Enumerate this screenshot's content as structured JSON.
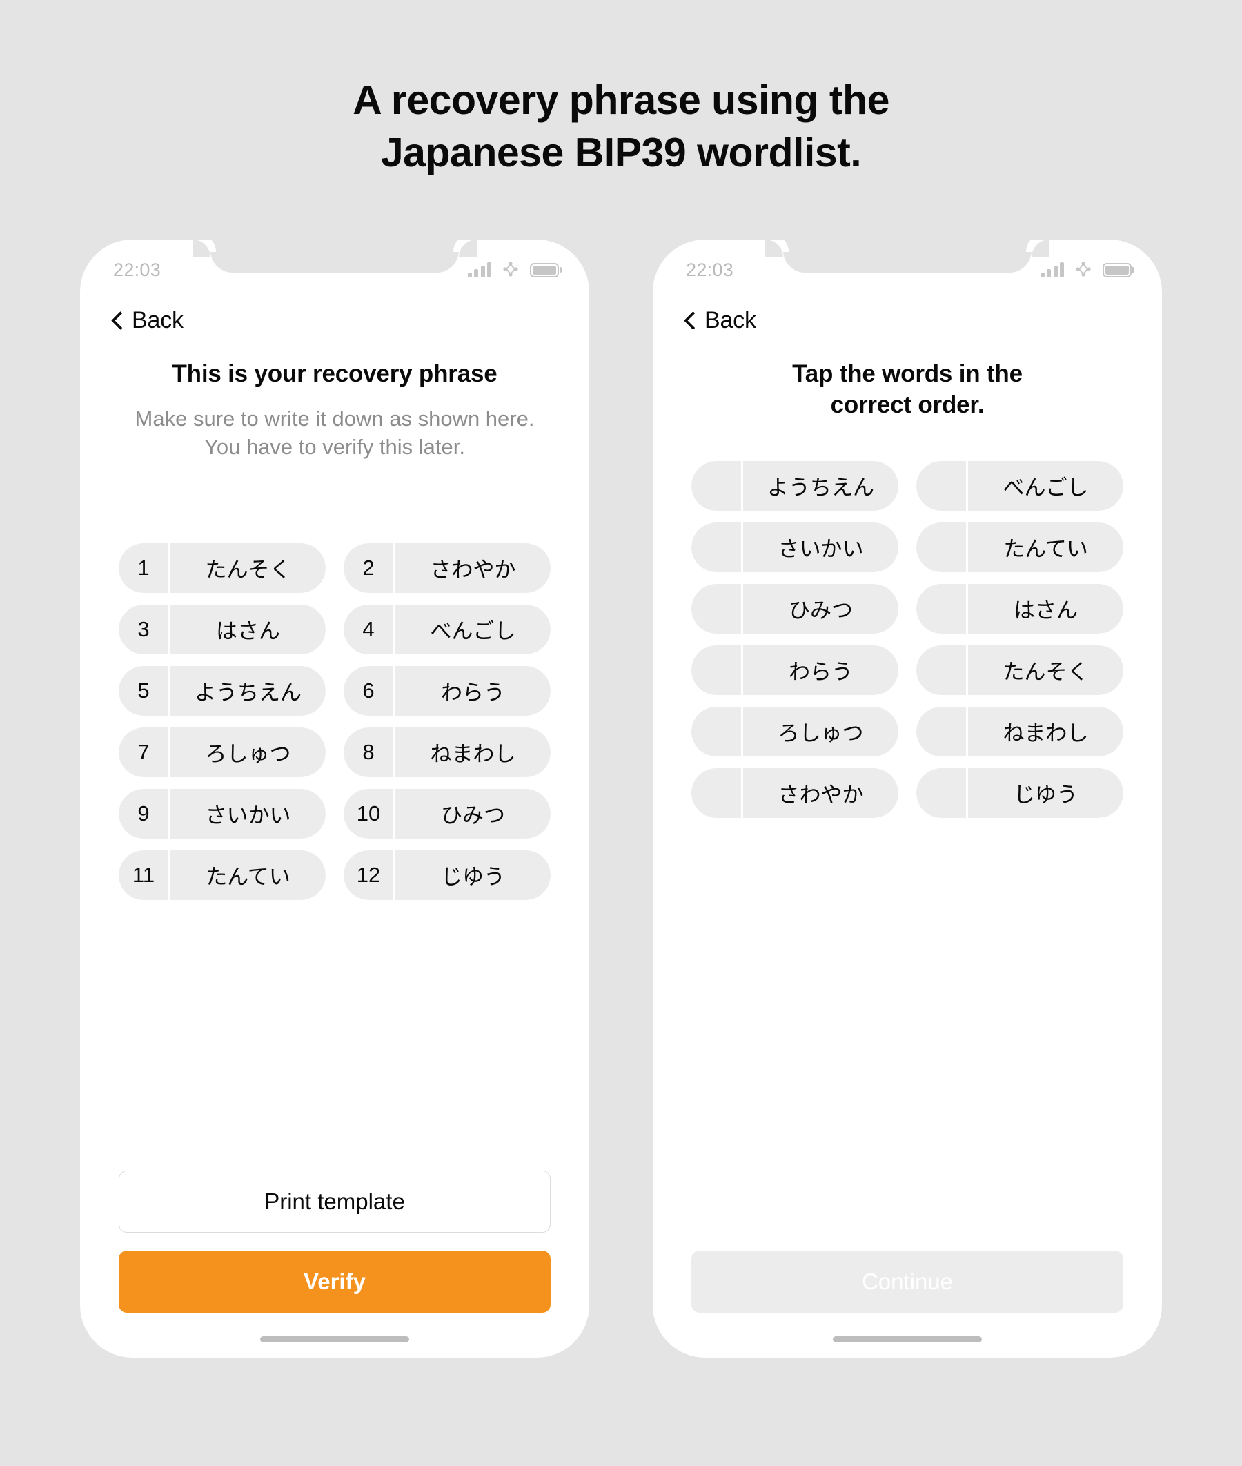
{
  "page": {
    "title_line1": "A recovery phrase using the",
    "title_line2": "Japanese BIP39 wordlist.",
    "background_color": "#e4e4e4"
  },
  "status_bar": {
    "time": "22:03",
    "signal_icon": "signal-bars-icon",
    "network_icon": "network-diamond-icon",
    "battery_icon": "battery-icon"
  },
  "phone_left": {
    "back_label": "Back",
    "back_icon": "chevron-left-icon",
    "title": "This is your recovery phrase",
    "subtitle": "Make sure to write it down as shown here. You have to verify this later.",
    "words": [
      {
        "num": "1",
        "word": "たんそく"
      },
      {
        "num": "2",
        "word": "さわやか"
      },
      {
        "num": "3",
        "word": "はさん"
      },
      {
        "num": "4",
        "word": "べんごし"
      },
      {
        "num": "5",
        "word": "ようちえん"
      },
      {
        "num": "6",
        "word": "わらう"
      },
      {
        "num": "7",
        "word": "ろしゅつ"
      },
      {
        "num": "8",
        "word": "ねまわし"
      },
      {
        "num": "9",
        "word": "さいかい"
      },
      {
        "num": "10",
        "word": "ひみつ"
      },
      {
        "num": "11",
        "word": "たんてい"
      },
      {
        "num": "12",
        "word": "じゆう"
      }
    ],
    "print_button": "Print template",
    "verify_button": "Verify",
    "verify_color": "#F5921E"
  },
  "phone_right": {
    "back_label": "Back",
    "back_icon": "chevron-left-icon",
    "title_line1": "Tap the words in the",
    "title_line2": "correct order.",
    "words": [
      {
        "num": "",
        "word": "ようちえん"
      },
      {
        "num": "",
        "word": "べんごし"
      },
      {
        "num": "",
        "word": "さいかい"
      },
      {
        "num": "",
        "word": "たんてい"
      },
      {
        "num": "",
        "word": "ひみつ"
      },
      {
        "num": "",
        "word": "はさん"
      },
      {
        "num": "",
        "word": "わらう"
      },
      {
        "num": "",
        "word": "たんそく"
      },
      {
        "num": "",
        "word": "ろしゅつ"
      },
      {
        "num": "",
        "word": "ねまわし"
      },
      {
        "num": "",
        "word": "さわやか"
      },
      {
        "num": "",
        "word": "じゆう"
      }
    ],
    "continue_button": "Continue"
  }
}
